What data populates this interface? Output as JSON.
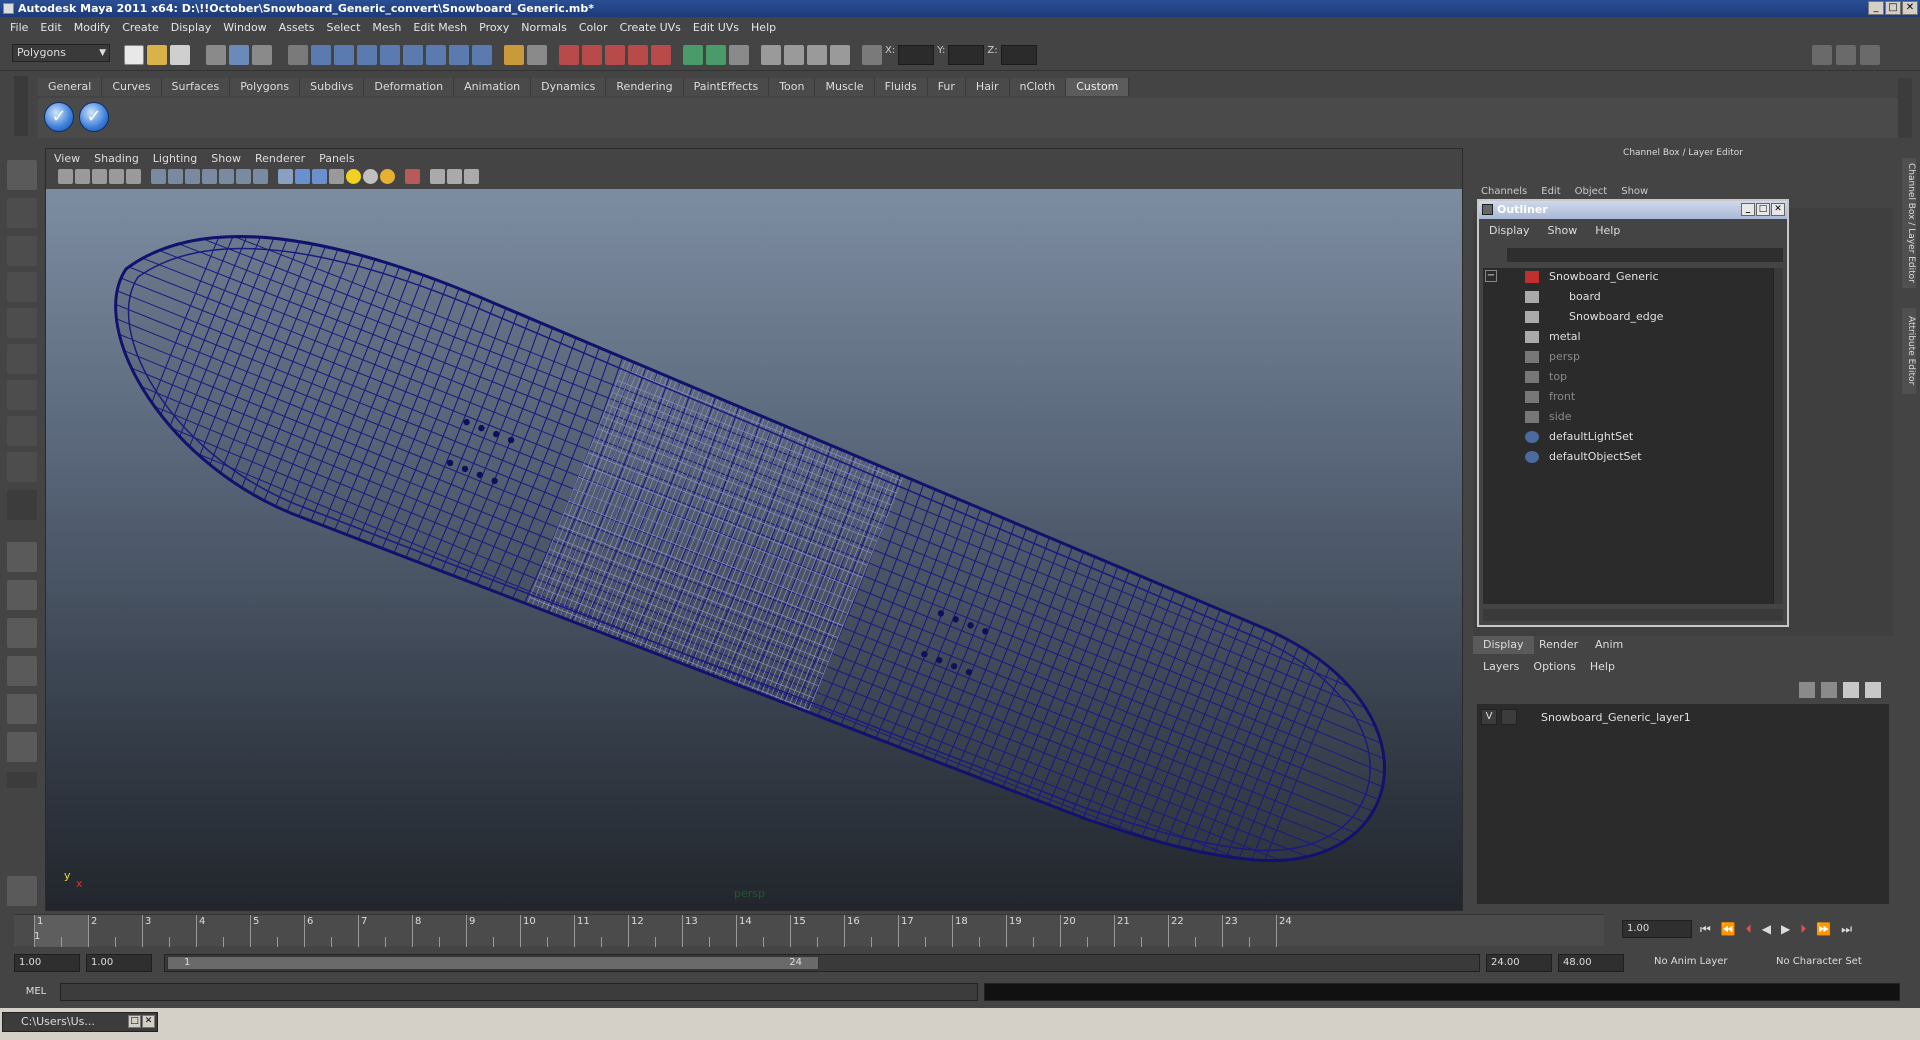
{
  "window": {
    "title": "Autodesk Maya 2011 x64: D:\\!!October\\Snowboard_Generic_convert\\Snowboard_Generic.mb*",
    "min": "_",
    "max": "□",
    "close": "✕"
  },
  "menubar": [
    "File",
    "Edit",
    "Modify",
    "Create",
    "Display",
    "Window",
    "Assets",
    "Select",
    "Mesh",
    "Edit Mesh",
    "Proxy",
    "Normals",
    "Color",
    "Create UVs",
    "Edit UVs",
    "Help"
  ],
  "statusline": {
    "mode": "Polygons",
    "x_label": "X:",
    "y_label": "Y:",
    "z_label": "Z:"
  },
  "shelf": {
    "tabs": [
      "General",
      "Curves",
      "Surfaces",
      "Polygons",
      "Subdivs",
      "Deformation",
      "Animation",
      "Dynamics",
      "Rendering",
      "PaintEffects",
      "Toon",
      "Muscle",
      "Fluids",
      "Fur",
      "Hair",
      "nCloth",
      "Custom"
    ],
    "active_tab": "Custom"
  },
  "viewport": {
    "menus": [
      "View",
      "Shading",
      "Lighting",
      "Show",
      "Renderer",
      "Panels"
    ],
    "camera_label": "persp",
    "axis_y": "y",
    "axis_x": "x",
    "wire_color": "#1a1a80"
  },
  "channelbox": {
    "title": "Channel Box / Layer Editor",
    "menus": [
      "Channels",
      "Edit",
      "Object",
      "Show"
    ]
  },
  "outliner": {
    "title": "Outliner",
    "menus": [
      "Display",
      "Show",
      "Help"
    ],
    "expand": "−",
    "items": [
      {
        "label": "Snowboard_Generic",
        "dim": false
      },
      {
        "label": "board",
        "dim": false
      },
      {
        "label": "Snowboard_edge",
        "dim": false
      },
      {
        "label": "metal",
        "dim": false
      },
      {
        "label": "persp",
        "dim": true
      },
      {
        "label": "top",
        "dim": true
      },
      {
        "label": "front",
        "dim": true
      },
      {
        "label": "side",
        "dim": true
      },
      {
        "label": "defaultLightSet",
        "dim": false
      },
      {
        "label": "defaultObjectSet",
        "dim": false
      }
    ]
  },
  "layers": {
    "tabs": [
      "Display",
      "Render",
      "Anim"
    ],
    "active_tab": "Display",
    "menus": [
      "Layers",
      "Options",
      "Help"
    ],
    "rows": [
      {
        "visible": "V",
        "name": "Snowboard_Generic_layer1"
      }
    ]
  },
  "side_tabs": [
    "Channel Box / Layer Editor",
    "Attribute Editor"
  ],
  "timeslider": {
    "ticks": [
      "1",
      "2",
      "3",
      "4",
      "5",
      "6",
      "7",
      "8",
      "9",
      "10",
      "11",
      "12",
      "13",
      "14",
      "15",
      "16",
      "17",
      "18",
      "19",
      "20",
      "21",
      "22",
      "23",
      "24"
    ],
    "current_marker": "1",
    "current_frame": "1.00"
  },
  "rangeslider": {
    "start": "1.00",
    "anim_start": "1.00",
    "range_start_label": "1",
    "range_end_label": "24",
    "anim_end": "24.00",
    "end": "48.00",
    "anim_layer": "No Anim Layer",
    "character_set": "No Character Set"
  },
  "cmdline": {
    "label": "MEL"
  },
  "taskbar": {
    "item": "C:\\Users\\Us..."
  }
}
